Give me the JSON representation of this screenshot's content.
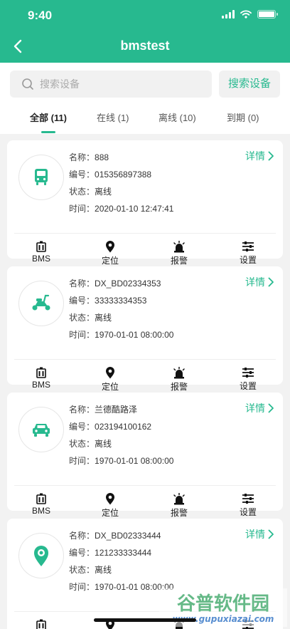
{
  "status_bar": {
    "time": "9:40"
  },
  "header": {
    "title": "bmstest"
  },
  "search": {
    "placeholder": "搜索设备",
    "button_label": "搜索设备"
  },
  "tabs": [
    {
      "label": "全部 (11)",
      "active": true
    },
    {
      "label": "在线 (1)",
      "active": false
    },
    {
      "label": "离线 (10)",
      "active": false
    },
    {
      "label": "到期 (0)",
      "active": false
    }
  ],
  "labels": {
    "name": "名称：",
    "number": "编号：",
    "status": "状态：",
    "time": "时间：",
    "detail": "详情"
  },
  "actions": [
    "BMS",
    "定位",
    "报警",
    "设置"
  ],
  "devices": [
    {
      "icon": "bus-icon",
      "name": "888",
      "number": "015356897388",
      "status": "离线",
      "time": "2020-01-10 12:47:41"
    },
    {
      "icon": "scooter-icon",
      "name": "DX_BD02334353",
      "number": "33333334353",
      "status": "离线",
      "time": "1970-01-01 08:00:00"
    },
    {
      "icon": "car-icon",
      "name": "兰德酷路泽",
      "number": "023194100162",
      "status": "离线",
      "time": "1970-01-01 08:00:00"
    },
    {
      "icon": "location-pin-icon",
      "name": "DX_BD02333444",
      "number": "121233333444",
      "status": "离线",
      "time": "1970-01-01 08:00:00"
    }
  ],
  "watermark": {
    "text": "谷普软件园",
    "url": "www.gupuxiazai.com"
  },
  "colors": {
    "accent": "#27b98f",
    "background": "#f2f2f2"
  }
}
